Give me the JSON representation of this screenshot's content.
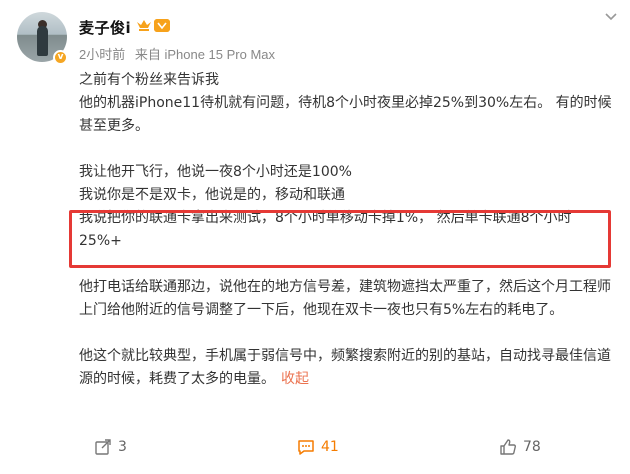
{
  "header": {
    "username": "麦子俊i",
    "time": "2小时前",
    "source": "来自 iPhone 15 Pro Max"
  },
  "post": {
    "lines": [
      "之前有个粉丝来告诉我",
      "他的机器iPhone11待机就有问题，待机8个小时夜里必掉25%到30%左右。 有的时候甚至更多。",
      "我让他开飞行，他说一夜8个小时还是100%",
      "我说你是不是双卡，他说是的，移动和联通",
      "我说把你的联通卡拿出来测试，8个小时单移动卡掉1%， 然后单卡联通8个小时25%+",
      "他打电话给联通那边，说他在的地方信号差，建筑物遮挡太严重了，然后这个月工程师上门给他附近的信号调整了一下后，他现在双卡一夜也只有5%左右的耗电了。",
      "他这个就比较典型，手机属于弱信号中，频繁搜索附近的别的基站，自动找寻最佳信道源的时候，耗费了太多的电量。"
    ],
    "collapse_label": "收起"
  },
  "actions": {
    "repost_count": "3",
    "comment_count": "41",
    "like_count": "78"
  },
  "colors": {
    "highlight_border": "#e53935",
    "link": "#eb7350",
    "comment_accent": "#f57c00"
  }
}
